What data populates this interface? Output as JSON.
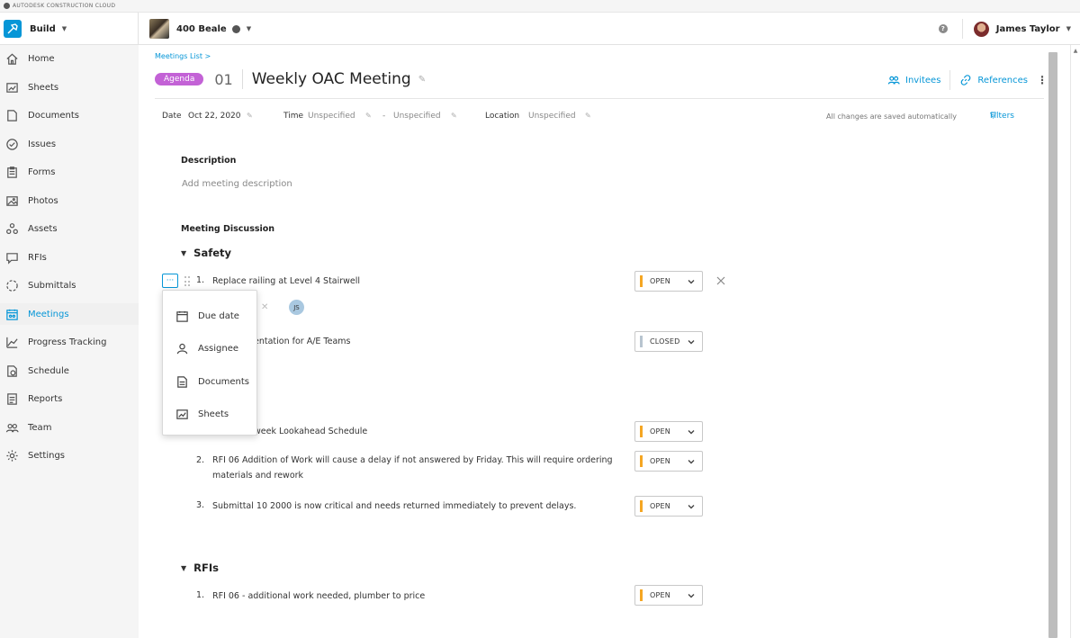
{
  "app": {
    "brand": "AUTODESK CONSTRUCTION CLOUD",
    "module": "Build",
    "project": "400 Beale",
    "user": "James Taylor"
  },
  "sidebar": {
    "items": [
      {
        "label": "Home",
        "icon": "home-icon"
      },
      {
        "label": "Sheets",
        "icon": "sheets-icon"
      },
      {
        "label": "Documents",
        "icon": "documents-icon"
      },
      {
        "label": "Issues",
        "icon": "issues-icon"
      },
      {
        "label": "Forms",
        "icon": "forms-icon"
      },
      {
        "label": "Photos",
        "icon": "photos-icon"
      },
      {
        "label": "Assets",
        "icon": "assets-icon"
      },
      {
        "label": "RFIs",
        "icon": "rfis-icon"
      },
      {
        "label": "Submittals",
        "icon": "submittals-icon"
      },
      {
        "label": "Meetings",
        "icon": "meetings-icon",
        "active": true
      },
      {
        "label": "Progress Tracking",
        "icon": "progress-icon"
      },
      {
        "label": "Schedule",
        "icon": "schedule-icon"
      },
      {
        "label": "Reports",
        "icon": "reports-icon"
      },
      {
        "label": "Team",
        "icon": "team-icon"
      },
      {
        "label": "Settings",
        "icon": "settings-icon"
      }
    ]
  },
  "meeting": {
    "breadcrumb": "Meetings List >",
    "badge": "Agenda",
    "number": "01",
    "title": "Weekly OAC Meeting",
    "invitees": "Invitees",
    "references": "References"
  },
  "meta": {
    "date_label": "Date",
    "date_value": "Oct 22, 2020",
    "time_label": "Time",
    "time_start": "Unspecified",
    "time_sep": "-",
    "time_end": "Unspecified",
    "location_label": "Location",
    "location_value": "Unspecified",
    "autosave": "All changes are saved automatically",
    "filters": "Filters"
  },
  "description": {
    "label": "Description",
    "placeholder": "Add meeting description"
  },
  "discussion": {
    "label": "Meeting Discussion",
    "safety": {
      "title": "Safety",
      "item1": {
        "num": "1.",
        "text": "Replace railing at Level 4 Stairwell",
        "status": "OPEN",
        "assignee": "JS"
      },
      "item2": {
        "text": "entation for A/E Teams",
        "status": "CLOSED"
      }
    },
    "schedule": {
      "item1": {
        "text": "week Lookahead Schedule",
        "status": "OPEN"
      },
      "item2": {
        "num": "2.",
        "line1": "RFI 06 Addition of Work will cause a delay if not answered by Friday. This will require ordering",
        "line2": "materials and rework",
        "status": "OPEN"
      },
      "item3": {
        "num": "3.",
        "text": "Submittal 10 2000 is now critical and needs returned immediately to prevent delays.",
        "status": "OPEN"
      }
    },
    "rfis": {
      "title": "RFIs",
      "item1": {
        "num": "1.",
        "text": "RFI 06 - additional work needed, plumber to price",
        "status": "OPEN"
      }
    }
  },
  "popup": {
    "items": [
      "Due date",
      "Assignee",
      "Documents",
      "Sheets"
    ]
  },
  "colors": {
    "accent": "#0696d7",
    "badge": "#c362d6",
    "open": "#f5a623",
    "closed": "#b8c4cf"
  }
}
